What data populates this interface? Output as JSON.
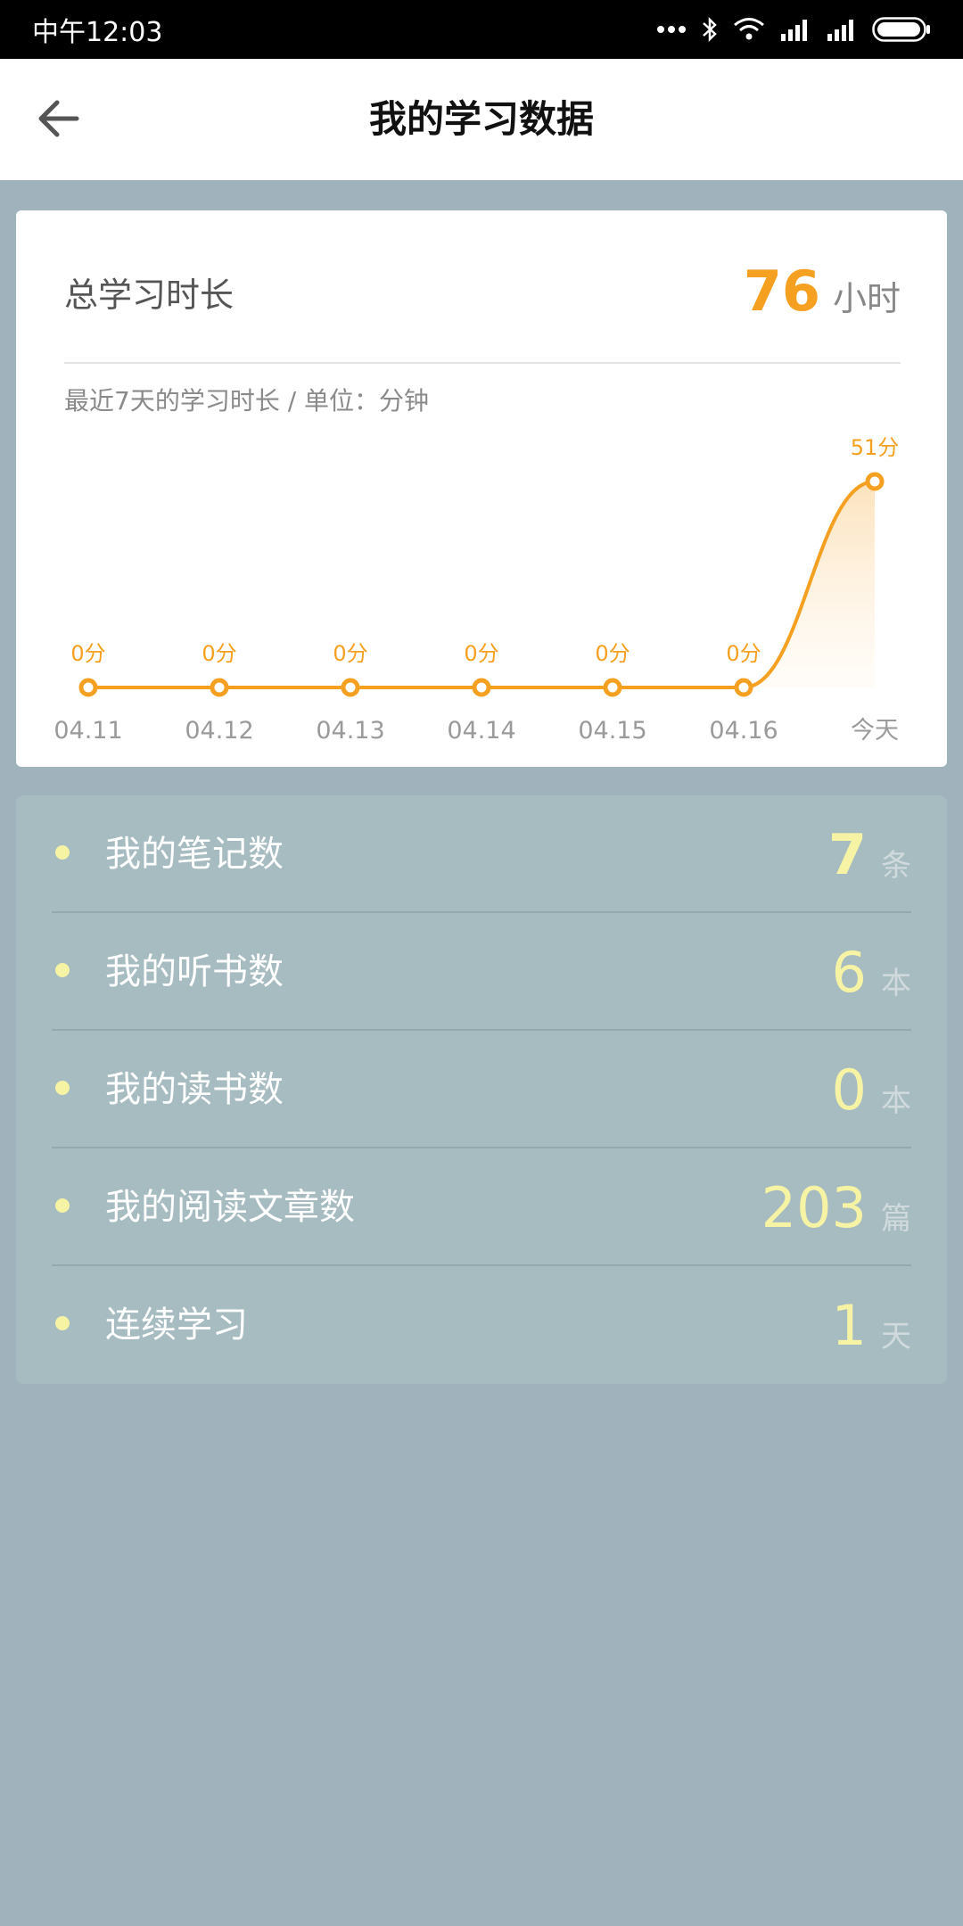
{
  "status_bar": {
    "time": "中午12:03",
    "icons": [
      "more-dots-icon",
      "bluetooth-icon",
      "wifi-icon",
      "signal-icon",
      "signal-icon",
      "battery-icon"
    ]
  },
  "header": {
    "title": "我的学习数据",
    "back_icon": "arrow-left-icon"
  },
  "summary": {
    "total_label": "总学习时长",
    "total_value": "76",
    "total_unit": "小时",
    "chart_subtitle": "最近7天的学习时长 / 单位：分钟"
  },
  "chart_data": {
    "type": "area",
    "title": "",
    "xlabel": "",
    "ylabel": "",
    "categories": [
      "04.11",
      "04.12",
      "04.13",
      "04.14",
      "04.15",
      "04.16",
      "今天"
    ],
    "values": [
      0,
      0,
      0,
      0,
      0,
      0,
      51
    ],
    "data_labels": [
      "0分",
      "0分",
      "0分",
      "0分",
      "0分",
      "0分",
      "51分"
    ],
    "ylim": [
      0,
      51
    ],
    "grid": false,
    "color": "#f5a021"
  },
  "stats": [
    {
      "label": "我的笔记数",
      "value": "7",
      "unit": "条"
    },
    {
      "label": "我的听书数",
      "value": "6",
      "unit": "本"
    },
    {
      "label": "我的读书数",
      "value": "0",
      "unit": "本"
    },
    {
      "label": "我的阅读文章数",
      "value": "203",
      "unit": "篇"
    },
    {
      "label": "连续学习",
      "value": "1",
      "unit": "天"
    }
  ],
  "colors": {
    "accent": "#f5a021",
    "background": "#a0b3bc",
    "stat_value": "#f6f3a4"
  }
}
